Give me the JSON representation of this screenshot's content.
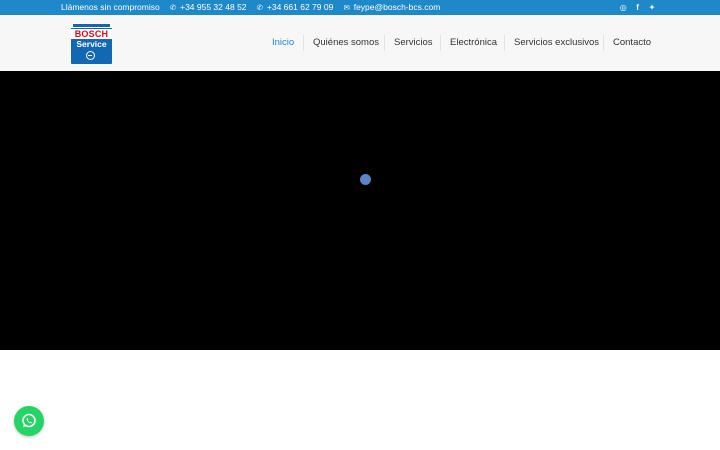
{
  "topbar": {
    "tagline": "Llámenos sin compromiso",
    "phones": [
      "+34 955 32 48 52",
      "+34 661 62 79 09"
    ],
    "email": "feype@bosch-bcs.com",
    "social_icons": [
      "whatsapp-icon",
      "facebook-icon",
      "twitter-icon"
    ]
  },
  "logo": {
    "brand": "BOSCH",
    "sub": "Service"
  },
  "nav": {
    "items": [
      {
        "label": "Inicio",
        "active": true
      },
      {
        "label": "Quiénes somos",
        "active": false
      },
      {
        "label": "Servicios",
        "active": false
      },
      {
        "label": "Electrónica",
        "active": false
      },
      {
        "label": "Servicios exclusivos",
        "active": false
      },
      {
        "label": "Contacto",
        "active": false
      }
    ]
  },
  "hero": {
    "loading_icon": "loader-dot-icon"
  },
  "floating": {
    "whatsapp_icon": "whatsapp-icon"
  },
  "colors": {
    "topbar": "#1e88c9",
    "nav_active": "#1e88c9",
    "hero_bg": "#000000",
    "whatsapp": "#25d366"
  }
}
